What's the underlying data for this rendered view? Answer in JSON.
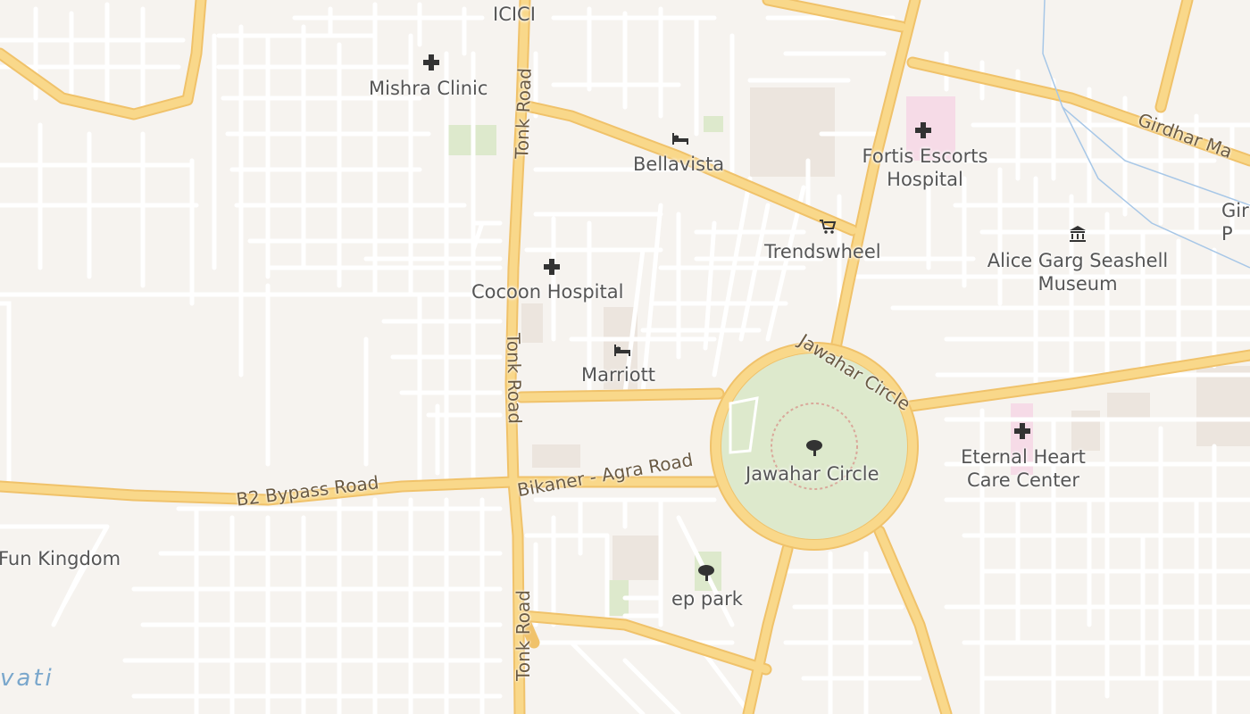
{
  "map": {
    "colors": {
      "land": "#f6f3ef",
      "minor_road": "#ffffff",
      "major_road": "#f9d88a",
      "major_casing": "#f0c26a",
      "park": "#dde9cc",
      "hospital_area": "#f6dbe7",
      "building": "#ece5de",
      "water": "#a7c7e7"
    },
    "places": {
      "icici": "ICICI",
      "mishra_clinic": "Mishra Clinic",
      "bellavista": "Bellavista",
      "fortis_line1": "Fortis Escorts",
      "fortis_line2": "Hospital",
      "trendswheel": "Trendswheel",
      "alice_line1": "Alice Garg Seashell",
      "alice_line2": "Museum",
      "cocoon_hospital": "Cocoon Hospital",
      "marriott": "Marriott",
      "jawahar_circle": "Jawahar Circle",
      "eternal_line1": "Eternal Heart",
      "eternal_line2": "Care Center",
      "ep_park": "ep park",
      "fun_kingdom": "Fun Kingdom",
      "gir_partial1": "Gir",
      "gir_partial2": "P"
    },
    "roads": {
      "tonk_road": "Tonk Road",
      "jawahar_circle_road": "Jawahar Circle",
      "b2_bypass": "B2 Bypass Road",
      "bikaner_agra": "Bikaner - Agra Road",
      "girdhar": "Girdhar Ma"
    },
    "water_label": "vati",
    "icons": [
      "hospital-cross-icon",
      "hotel-bed-icon",
      "shopping-cart-icon",
      "museum-icon",
      "tree-icon"
    ]
  }
}
